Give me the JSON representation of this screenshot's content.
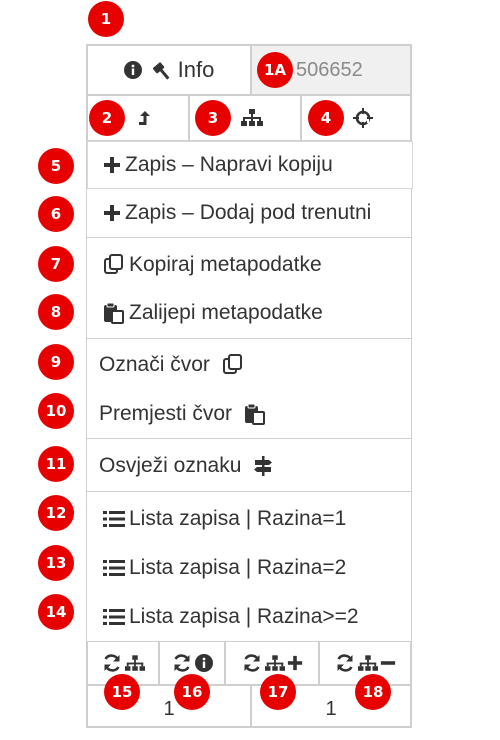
{
  "badges": [
    "1",
    "1A",
    "2",
    "3",
    "4",
    "5",
    "6",
    "7",
    "8",
    "9",
    "10",
    "11",
    "12",
    "13",
    "14",
    "15",
    "16",
    "17",
    "18"
  ],
  "header": {
    "info_label": "Info",
    "id_value": "506652"
  },
  "toolbar": {
    "up_icon": "arrow-up-icon",
    "tree_icon": "sitemap-icon",
    "locate_icon": "crosshair-icon"
  },
  "menu": {
    "item5": "Zapis – Napravi kopiju",
    "item6": "Zapis – Dodaj pod trenutni",
    "item7": "Kopiraj metapodatke",
    "item8": "Zalijepi metapodatke",
    "item9": "Označi čvor",
    "item10": "Premjesti čvor",
    "item11": "Osvježi oznaku",
    "item12": "Lista zapisa | Razina=1",
    "item13": "Lista zapisa | Razina=2",
    "item14": "Lista zapisa | Razina>=2"
  },
  "footer": {
    "count_left": "1",
    "count_right": "1"
  },
  "colors": {
    "badge": "#e60000",
    "border": "#cfcfcf",
    "text": "#333333"
  }
}
